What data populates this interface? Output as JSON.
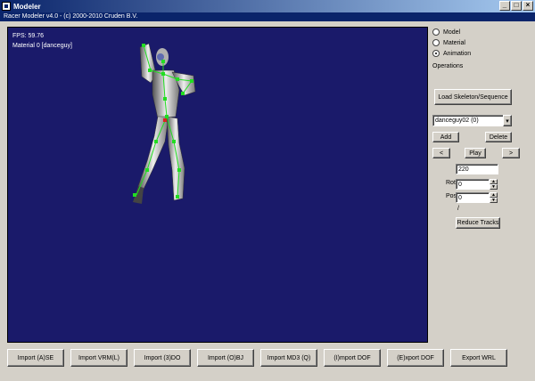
{
  "window": {
    "title": "Modeler",
    "subtitle": "Racer Modeler v4.0 - (c) 2000-2010 Cruden B.V.",
    "controls": [
      "_",
      "□",
      "×"
    ]
  },
  "viewport": {
    "fps": "FPS: 59.76",
    "material": "Material 0 [danceguy]",
    "background": "#1a1a6a",
    "joint_color": "#22dd22"
  },
  "panel": {
    "modes": [
      {
        "label": "Model",
        "checked": false
      },
      {
        "label": "Material",
        "checked": false
      },
      {
        "label": "Animation",
        "checked": true
      }
    ],
    "operations_label": "Operations",
    "load_button": "Load Skeleton/Sequence",
    "sequence_value": "danceguy02 (0)",
    "add_button": "Add",
    "delete_button": "Delete",
    "prev_button": "<",
    "play_button": "Play",
    "next_button": ">",
    "frame_value": "220",
    "rot_label": "Rot",
    "rot_value": "0",
    "pos_label": "Pos",
    "pos_value": "0",
    "slash": "/",
    "reduce_button": "Reduce Tracks"
  },
  "bottom_buttons": [
    "Import (A)SE",
    "Import VRM(L)",
    "Import (3)DO",
    "Import (O)BJ",
    "Import MD3 (Q)",
    "(I)mport DOF",
    "(E)xport DOF",
    "Export WRL"
  ]
}
